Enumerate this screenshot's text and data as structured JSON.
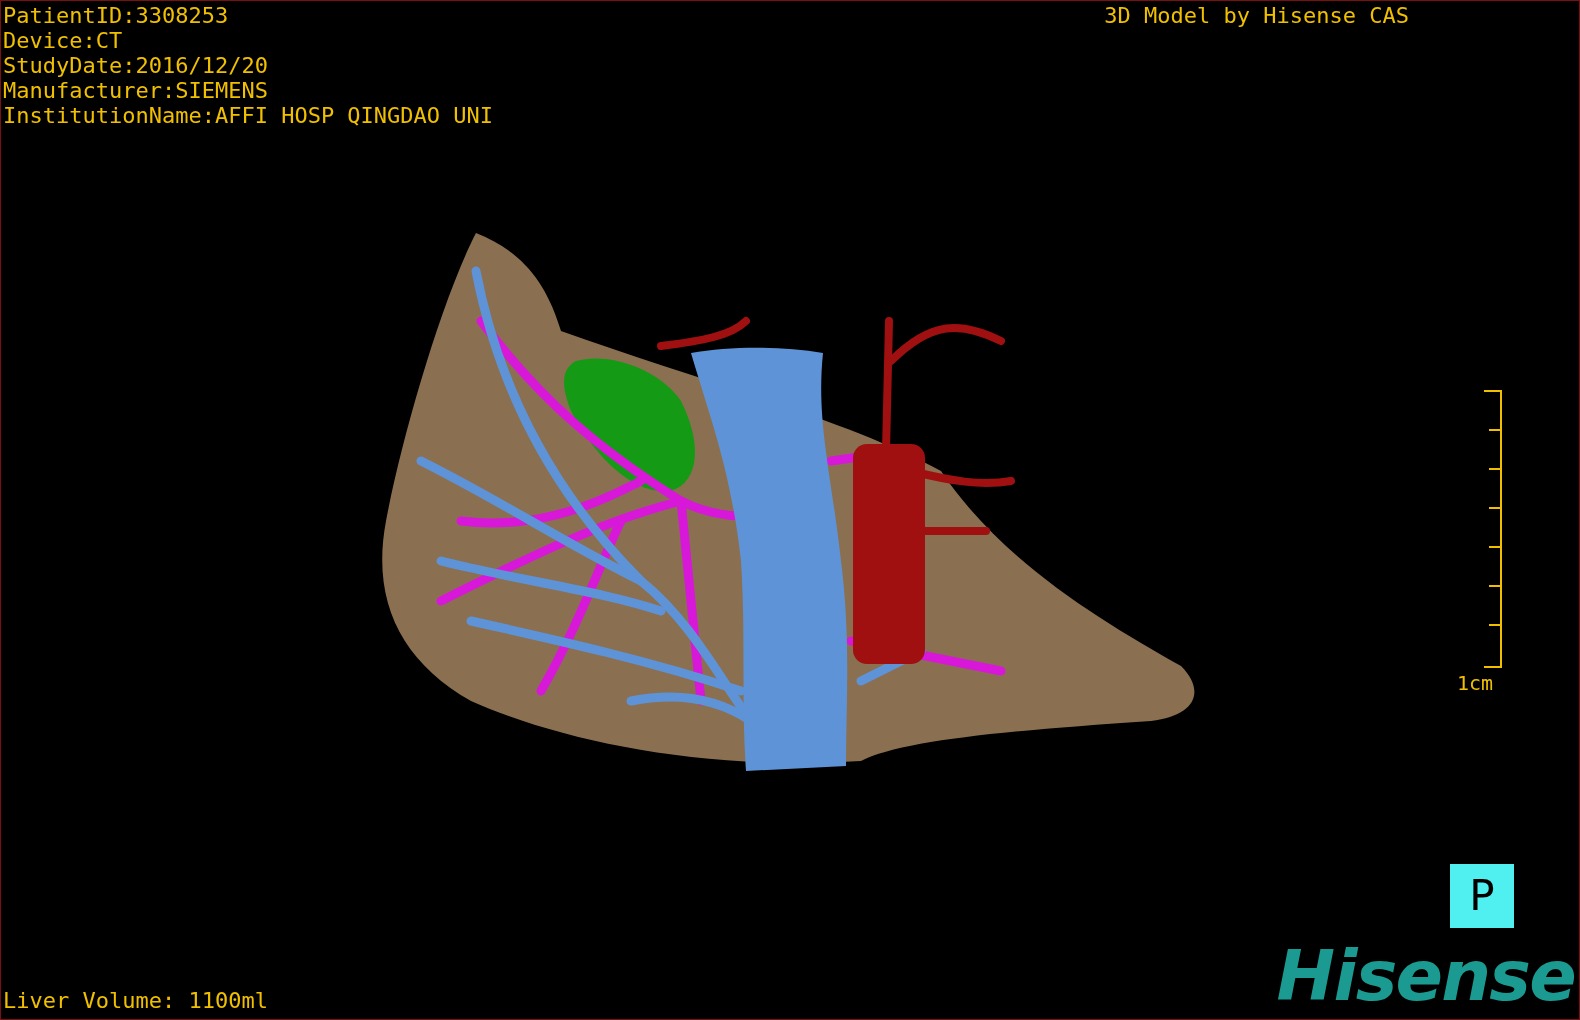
{
  "patient_info": [
    "PatientID:3308253",
    "Device:CT",
    "StudyDate:2016/12/20",
    "Manufacturer:SIEMENS",
    "InstitutionName:AFFI HOSP QINGDAO UNI"
  ],
  "credit": "3D Model by Hisense CAS",
  "scale_bar": {
    "label": "1cm"
  },
  "orientation_marker": "P",
  "liver_volume": "Liver Volume: 1100ml",
  "logo": "Hisense"
}
